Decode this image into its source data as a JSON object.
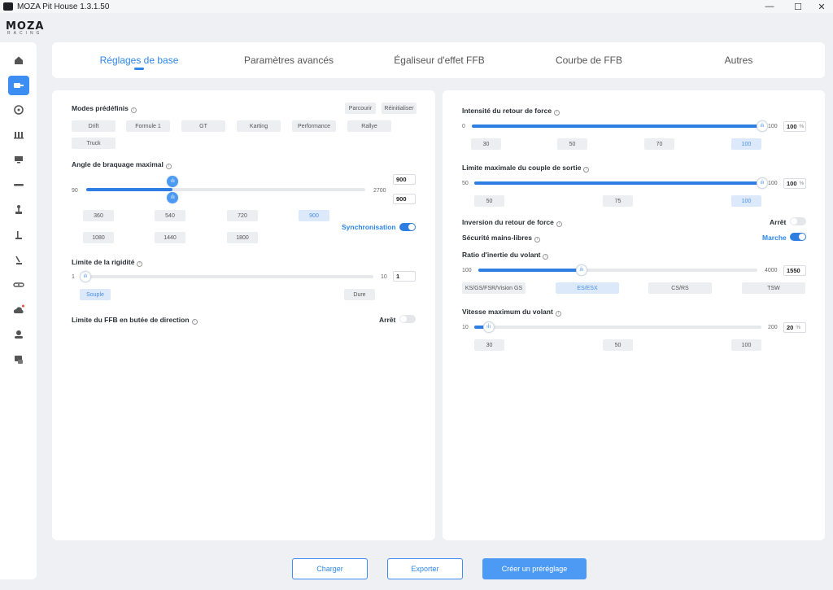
{
  "window": {
    "title": "MOZA Pit House 1.3.1.50",
    "minimize": "—",
    "maximize": "☐",
    "close": "✕"
  },
  "logo": {
    "brand": "MOZA",
    "sub": "RACING"
  },
  "tabs": [
    "Réglages de base",
    "Paramètres avancés",
    "Égaliseur d'effet FFB",
    "Courbe de FFB",
    "Autres"
  ],
  "left": {
    "modes": {
      "label": "Modes prédéfinis",
      "browse": "Parcourir",
      "reset": "Réinitialiser",
      "items": [
        "Drift",
        "Formule 1",
        "GT",
        "Karting",
        "Performance",
        "Rallye",
        "Truck"
      ]
    },
    "steering": {
      "label": "Angle de braquage maximal",
      "min": "90",
      "max": "2700",
      "value1": "900",
      "value2": "900",
      "level": 0.31,
      "presets": [
        "360",
        "540",
        "720",
        "900",
        "1080",
        "1440",
        "1800"
      ],
      "selected": "900",
      "sync_label": "Synchronisation"
    },
    "stiffness": {
      "label": "Limite de la rigidité",
      "min": "1",
      "max": "10",
      "value": "1",
      "soft": "Souple",
      "hard": "Dure"
    },
    "endstop": {
      "label": "Limite du FFB en butée de direction",
      "state": "Arrêt"
    }
  },
  "right": {
    "ffb": {
      "label": "Intensité du retour de force",
      "min": "0",
      "max": "100",
      "value": "100",
      "unit": "%",
      "level": 1.0,
      "presets": [
        "30",
        "50",
        "70",
        "100"
      ],
      "selected": "100"
    },
    "torque": {
      "label": "Limite maximale du couple de sortie",
      "min": "50",
      "max": "100",
      "value": "100",
      "unit": "%",
      "level": 1.0,
      "presets": [
        "50",
        "75",
        "100"
      ],
      "selected": "100"
    },
    "reverse": {
      "label": "Inversion du retour de force",
      "state": "Arrêt"
    },
    "handsoff": {
      "label": "Sécurité mains-libres",
      "state": "Marche"
    },
    "inertia": {
      "label": "Ratio d'inertie du volant",
      "min": "100",
      "max": "4000",
      "value": "1550",
      "level": 0.37,
      "presets": [
        "KS/GS/FSR/Vision GS",
        "ES/ESX",
        "CS/RS",
        "TSW"
      ],
      "selected": "ES/ESX"
    },
    "speed": {
      "label": "Vitesse maximum du volant",
      "min": "10",
      "max": "200",
      "value": "20",
      "unit": "%",
      "level": 0.05,
      "presets": [
        "30",
        "50",
        "100"
      ]
    }
  },
  "footer": {
    "load": "Charger",
    "export": "Exporter",
    "create": "Créer un préréglage"
  },
  "colors": {
    "accent": "#2f7fe3",
    "sidebar_active": "#3d8ef3"
  }
}
